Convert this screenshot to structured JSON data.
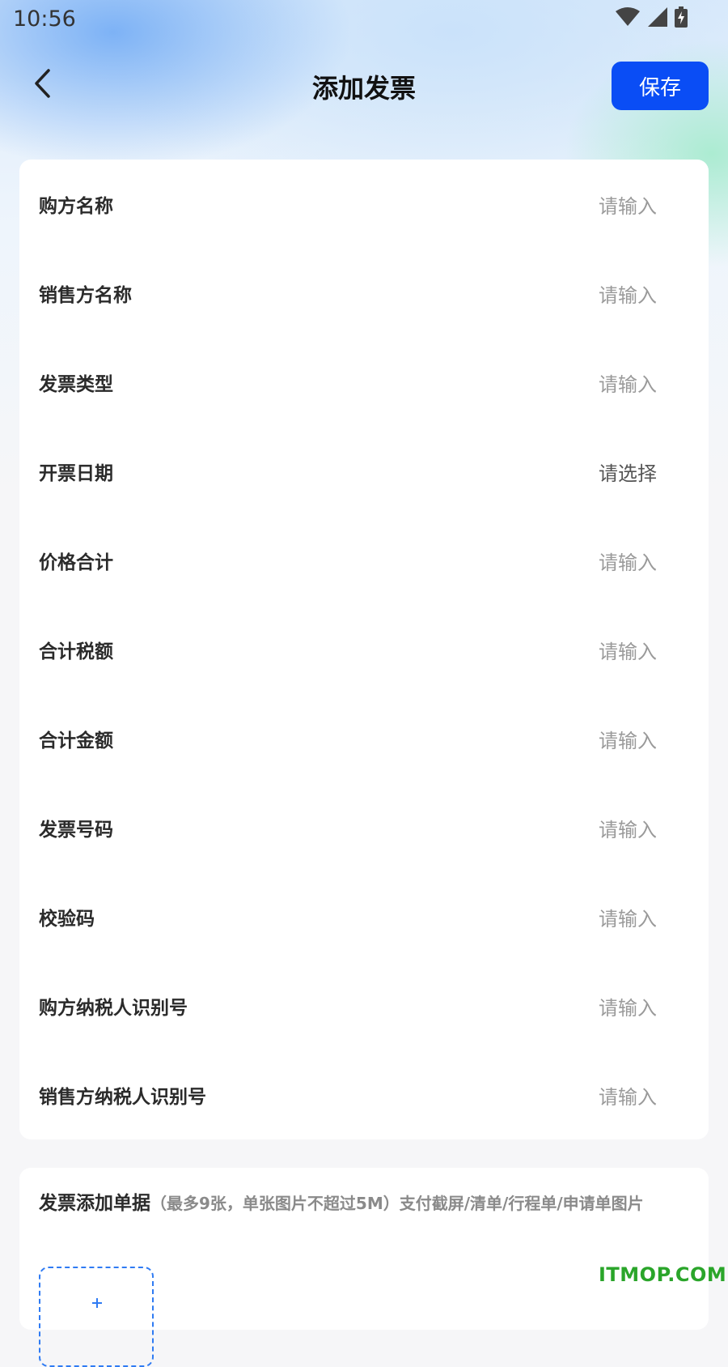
{
  "status_bar": {
    "time": "10:56"
  },
  "header": {
    "title": "添加发票",
    "save_label": "保存"
  },
  "form": {
    "rows": [
      {
        "label": "购方名称",
        "value": "请输入"
      },
      {
        "label": "销售方名称",
        "value": "请输入"
      },
      {
        "label": "发票类型",
        "value": "请输入"
      },
      {
        "label": "开票日期",
        "value": "请选择"
      },
      {
        "label": "价格合计",
        "value": "请输入"
      },
      {
        "label": "合计税额",
        "value": "请输入"
      },
      {
        "label": "合计金额",
        "value": "请输入"
      },
      {
        "label": "发票号码",
        "value": "请输入"
      },
      {
        "label": "校验码",
        "value": "请输入"
      },
      {
        "label": "购方纳税人识别号",
        "value": "请输入"
      },
      {
        "label": "销售方纳税人识别号",
        "value": "请输入"
      }
    ]
  },
  "attachments": {
    "title": "发票添加单据",
    "note": "（最多9张，单张图片不超过5M）支付截屏/清单/行程单/申请单图片"
  },
  "watermark": "ITMOP.COM",
  "colors": {
    "accent": "#0a4df5",
    "upload_border": "#2f7bf3",
    "watermark": "#2aa52a"
  }
}
